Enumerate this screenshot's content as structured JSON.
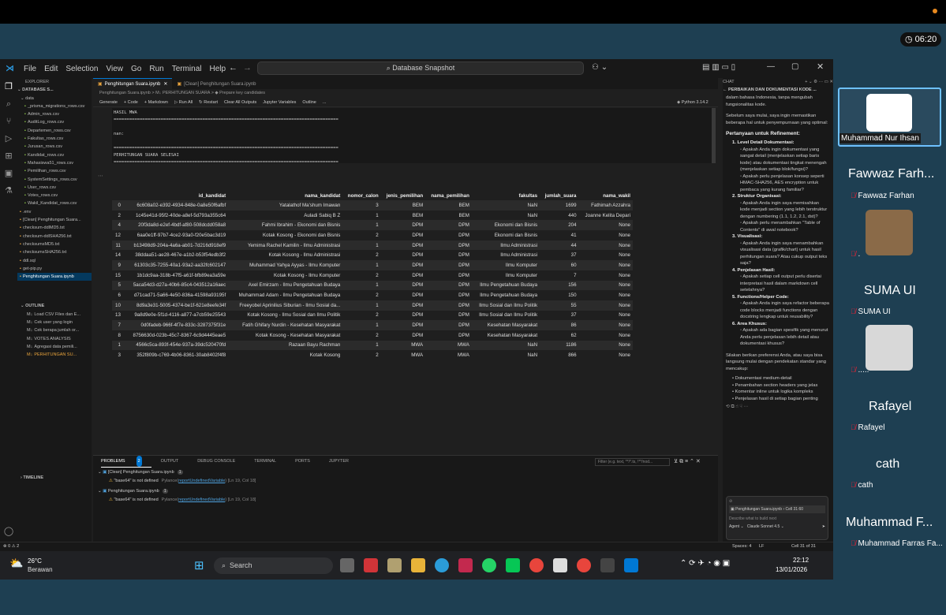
{
  "meeting": {
    "timer": "06:20"
  },
  "vscode": {
    "menu": [
      "File",
      "Edit",
      "Selection",
      "View",
      "Go",
      "Run",
      "Terminal",
      "Help"
    ],
    "search": "Database Snapshot",
    "explorer": {
      "title": "EXPLORER",
      "root": "DATABASE S...",
      "folder": "data",
      "files": [
        "_prisma_migrations_rows.csv",
        "Admin_rows.csv",
        "AuditLog_rows.csv",
        "Departemen_rows.csv",
        "Fakultas_rows.csv",
        "Jurusan_rows.csv",
        "Kandidat_rows.csv",
        "Mahasiswa51_rows.csv",
        "Pemilihan_rows.csv",
        "SystemSettings_rows.csv",
        "User_rows.csv",
        "Votes_rows.csv",
        "Wakil_Kandidat_rows.csv",
        ".env",
        "[Clean] Penghitungan Suara...",
        "checksum-ddlMD5.txt",
        "checksum-ddlSHA256.txt",
        "checksumsMD5.txt",
        "checksumsSHA256.txt",
        "ddl.sql",
        "get-pip.py",
        "Penghitungan Suara.ipynb"
      ],
      "outline_title": "OUTLINE",
      "outline": [
        "Load CSV Files dan E...",
        "Cek user yang login",
        "Cek berapa jumlah or...",
        "VOTES ANALYSIS",
        "Agregasi data pemili...",
        "PERHITUNGAN SU..."
      ],
      "timeline": "TIMELINE"
    },
    "tabs": [
      "Penghitungan Suara.ipynb",
      "[Clean] Penghitungan Suara.ipynb"
    ],
    "breadcrumb": "Penghitungan Suara.ipynb > M↓ PERHITUNGAN SUARA > ◆ Prepare key candidates",
    "toolbar": [
      "Generate",
      "+ Code",
      "+ Markdown",
      "▷ Run All",
      "↻ Restart",
      "Clear All Outputs",
      "Jupyter Variables",
      "Outline",
      "..."
    ],
    "kernel": "Python 3.14.2",
    "output_lines": [
      "HASIL MWA",
      "======================================================================================",
      "",
      "nan:",
      "",
      "======================================================================================",
      "PERHITUNGAN SUARA SELESAI",
      "======================================================================================"
    ],
    "df_headers": [
      "",
      "id_kandidat",
      "nama_kandidat",
      "nomor_calon",
      "jenis_pemilihan",
      "nama_pemilihan",
      "fakultas",
      "jumlah_suara",
      "nama_wakil"
    ],
    "df_rows": [
      [
        "0",
        "6c608a02-e392-4934-848e-0a8e50f6afbf",
        "Yatalathof Ma'shum Imawan",
        "3",
        "BEM",
        "BEM",
        "NaN",
        "1699",
        "Fathimah Azzahra"
      ],
      [
        "2",
        "1c45e41d-95f2-40de-a8ef-5d793a355c64",
        "Auladi Sabiq B Z",
        "1",
        "BEM",
        "BEM",
        "NaN",
        "440",
        "Joanne Kelita Depari"
      ],
      [
        "4",
        "20f3da8d-e2ef-4bdf-af80-508dcdd058a8",
        "Fahmi Ibrahim - Ekonomi dan Bisnis",
        "1",
        "DPM",
        "DPM",
        "Ekonomi dan Bisnis",
        "204",
        "None"
      ],
      [
        "12",
        "6aa0e1ff-97b7-4ce2-93a0-f20e5bac3d19",
        "Kotak Kosong - Ekonomi dan Bisnis",
        "2",
        "DPM",
        "DPM",
        "Ekonomi dan Bisnis",
        "41",
        "None"
      ],
      [
        "11",
        "b13498d9-204a-4a6a-ab01-7d216d918ef9",
        "Yemima Rachel Kamilin - Ilmu Administrasi",
        "1",
        "DPM",
        "DPM",
        "Ilmu Administrasi",
        "44",
        "None"
      ],
      [
        "14",
        "38ddaa51-ae28-467e-a1b2-b53f54edb3f2",
        "Kotak Kosong - Ilmu Administrasi",
        "2",
        "DPM",
        "DPM",
        "Ilmu Administrasi",
        "37",
        "None"
      ],
      [
        "9",
        "61303c35-7255-40a1-93a2-aa32fc602147",
        "Muhammad Yahya Ayyas - Ilmu Komputer",
        "1",
        "DPM",
        "DPM",
        "Ilmu Komputer",
        "60",
        "None"
      ],
      [
        "15",
        "1b1dc9aa-318b-47f5-a61f-bfb89ea3a59e",
        "Kotak Kosong - Ilmu Komputer",
        "2",
        "DPM",
        "DPM",
        "Ilmu Komputer",
        "7",
        "None"
      ],
      [
        "5",
        "5aca54d3-d27a-40b6-85c4-043512a16aec",
        "Axel Emirzam - Ilmu Pengetahuan Budaya",
        "1",
        "DPM",
        "DPM",
        "Ilmu Pengetahuan Budaya",
        "156",
        "None"
      ],
      [
        "6",
        "d71cad71-5a66-4e50-836a-41598a93195f",
        "Muhammad Adam - Ilmu Pengetahuan Budaya",
        "2",
        "DPM",
        "DPM",
        "Ilmu Pengetahuan Budaya",
        "150",
        "None"
      ],
      [
        "10",
        "8d9a3e31-5005-4374-be1f-621e8eefe34f",
        "Freeyobel Aprinilius Siburian - Ilmu Sosial da...",
        "1",
        "DPM",
        "DPM",
        "Ilmu Sosial dan Ilmu Politik",
        "55",
        "None"
      ],
      [
        "13",
        "9a8d9e0e-5f1d-4116-a877-a7cb59e25543",
        "Kotak Kosong - Ilmu Sosial dan Ilmu Politik",
        "2",
        "DPM",
        "DPM",
        "Ilmu Sosial dan Ilmu Politik",
        "37",
        "None"
      ],
      [
        "7",
        "0d0fadeb-966f-4f7e-833c-3287375f31e",
        "Fatih Ghifary Nurdin - Kesehatan Masyarakat",
        "1",
        "DPM",
        "DPM",
        "Kesehatan Masyarakat",
        "86",
        "None"
      ],
      [
        "8",
        "8756630d-023b-45c7-8367-6c9d4445eae5",
        "Kotak Kosong - Kesehatan Masyarakat",
        "2",
        "DPM",
        "DPM",
        "Kesehatan Masyarakat",
        "62",
        "None"
      ],
      [
        "1",
        "4566c5ca-893f-454e-937a-39dc520470fd",
        "Razaan Bayu Rachman",
        "1",
        "MWA",
        "MWA",
        "NaN",
        "1186",
        "None"
      ],
      [
        "3",
        "352f809b-c769-4b06-8361-30ab8402f4f8",
        "Kotak Kosong",
        "2",
        "MWA",
        "MWA",
        "NaN",
        "866",
        "None"
      ]
    ],
    "panel": {
      "tabs": [
        "PROBLEMS",
        "OUTPUT",
        "DEBUG CONSOLE",
        "TERMINAL",
        "PORTS",
        "JUPYTER"
      ],
      "count": "2",
      "filter": "Filter (e.g. text, **/*.ts, !**/nod...",
      "groups": [
        {
          "file": "[Clean] Penghitungan Suara.ipynb",
          "n": "1",
          "msg": "\"base64\" is not defined",
          "src": "Pylance(",
          "code": "reportUndefinedVariable",
          "pos": ") [Ln 19, Col 18]"
        },
        {
          "file": "Penghitungan Suara.ipynb",
          "n": "1",
          "msg": "\"base64\" is not defined",
          "src": "Pylance(",
          "code": "reportUndefinedVariable",
          "pos": ") [Ln 19, Col 18]"
        }
      ]
    },
    "chat": {
      "label": "CHAT",
      "title": "PERBAIKAN DAN DOKUMENTASI KODE ...",
      "intro1": "dalam bahasa Indonesia, tanpa mengubah fungsionalitas kode.",
      "intro2": "Sebelum saya mulai, saya ingin memastikan beberapa hal untuk penyempurnaan yang optimal:",
      "heading": "Pertanyaan untuk Refinement:",
      "items": [
        {
          "h": "Level Detail Dokumentasi:",
          "b": [
            "Apakah Anda ingin dokumentasi yang sangat detail (menjelaskan setiap baris kode) atau dokumentasi tingkat menengah (menjelaskan setiap blok/fungsi)?",
            "Apakah perlu penjelasan konsep seperti HMAC-SHA256, AES encryption untuk pembaca yang kurang familiar?"
          ]
        },
        {
          "h": "Struktur Organisasi:",
          "b": [
            "Apakah Anda ingin saya memisahkan kode menjadi section yang lebih terstruktur dengan numbering (1.1, 1.2, 2.1, dst)?",
            "Apakah perlu menambahkan \"Table of Contents\" di awal notebook?"
          ]
        },
        {
          "h": "Visualisasi:",
          "b": [
            "Apakah Anda ingin saya menambahkan visualisasi data (grafik/chart) untuk hasil perhitungan suara? Atau cukup output teks saja?"
          ]
        },
        {
          "h": "Penjelasan Hasil:",
          "b": [
            "Apakah setiap cell output perlu disertai interpretasi hasil dalam markdown cell setelahnya?"
          ]
        },
        {
          "h": "Functions/Helper Code:",
          "b": [
            "Apakah Anda ingin saya refactor beberapa code blocks menjadi functions dengan docstring lengkap untuk reusability?"
          ]
        },
        {
          "h": "Area Khusus:",
          "b": [
            "Apakah ada bagian spesifik yang menurut Anda perlu penjelasan lebih detail atau dokumentasi khusus?"
          ]
        }
      ],
      "outro": "Silakan berikan preferensi Anda, atau saya bisa langsung mulai dengan pendekatan standar yang mencakup:",
      "bullets": [
        "Dokumentasi medium-detail",
        "Penambahan section headers yang jelas",
        "Komentar inline untuk logika kompleks",
        "Penjelasan hasil di setiap bagian penting"
      ],
      "context": "Penghitungan Suara.ipynb › Cell 31:60",
      "placeholder": "Describe what to build next",
      "agent": "Agent",
      "model": "Claude Sonnet 4.5"
    },
    "status": {
      "spaces": "Spaces: 4",
      "lf": "LF",
      "cell": "Cell 31 of 31",
      "problems": "⊗ 0 ⚠ 2"
    }
  },
  "taskbar": {
    "temp": "26°C",
    "weather": "Berawan",
    "search": "Search",
    "time": "22:12",
    "date": "13/01/2026"
  },
  "participants": [
    {
      "name": "Muhammad Nur Ihsan"
    },
    {
      "big": "Fawwaz Farh...",
      "name": "Fawwaz Farhan"
    },
    {
      "name": "."
    },
    {
      "big": "SUMA UI",
      "name": "SUMA UI"
    },
    {
      "name": "....."
    },
    {
      "big": "Rafayel",
      "name": "Rafayel"
    },
    {
      "big": "cath",
      "name": "cath"
    },
    {
      "big": "Muhammad F...",
      "name": "Muhammad Farras Fa..."
    }
  ],
  "colors": {
    "accent": "#0078d4",
    "meeting_bg": "#1e3f52",
    "mic_off": "#e23030"
  }
}
